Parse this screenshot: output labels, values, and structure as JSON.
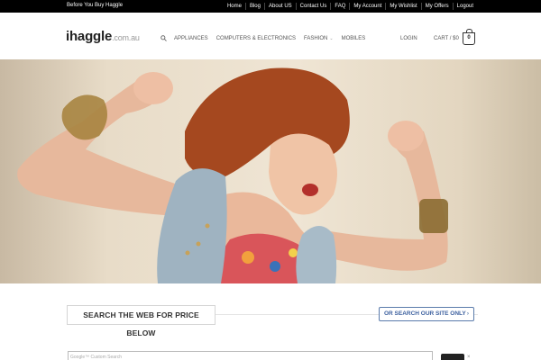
{
  "topbar": {
    "tagline": "Before You Buy Haggle",
    "links": [
      "Home",
      "Blog",
      "About US",
      "Contact Us",
      "FAQ",
      "My Account",
      "My Wishlist",
      "My Offers",
      "Logout"
    ]
  },
  "header": {
    "logo_main": "ihaggle",
    "logo_tld": ".com.au",
    "search_icon": "search-icon",
    "nav": [
      "APPLIANCES",
      "COMPUTERS & ELECTRONICS",
      "FASHION",
      "MOBILES"
    ],
    "login": "LOGIN",
    "cart_label": "CART / $0",
    "cart_count": "0"
  },
  "hero": {
    "image": "woman-dancing-photo"
  },
  "search_section": {
    "title": "SEARCH THE WEB FOR PRICE BELOW",
    "site_search_label": "OR SEARCH OUR SITE ONLY",
    "custom_search_placeholder": "Google™ Custom Search"
  },
  "colors": {
    "topbar_bg": "#000000",
    "accent_blue": "#3f62a0"
  }
}
